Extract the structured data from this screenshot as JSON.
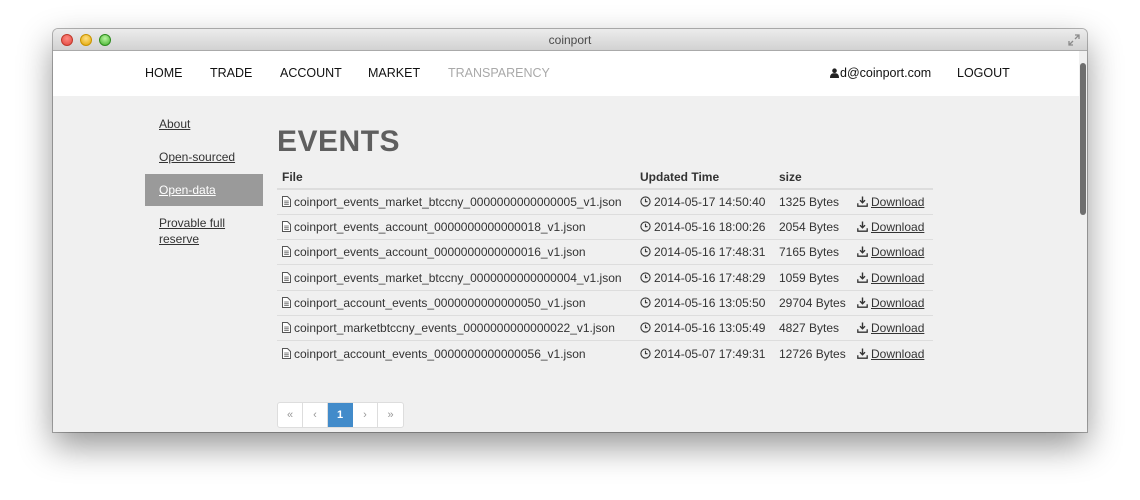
{
  "window": {
    "title": "coinport"
  },
  "nav": {
    "items": [
      "HOME",
      "TRADE",
      "ACCOUNT",
      "MARKET",
      "TRANSPARENCY"
    ],
    "user_email": "d@coinport.com",
    "logout": "LOGOUT"
  },
  "sidebar": {
    "items": [
      "About",
      "Open-sourced",
      "Open-data",
      "Provable full reserve"
    ],
    "active": "Open-data"
  },
  "page": {
    "title": "EVENTS"
  },
  "table": {
    "headers": [
      "File",
      "Updated Time",
      "size"
    ],
    "rows": [
      {
        "file": "coinport_events_market_btccny_0000000000000005_v1.json",
        "time": "2014-05-17 14:50:40",
        "size": "1325 Bytes",
        "action": "Download"
      },
      {
        "file": "coinport_events_account_0000000000000018_v1.json",
        "time": "2014-05-16 18:00:26",
        "size": "2054 Bytes",
        "action": "Download"
      },
      {
        "file": "coinport_events_account_0000000000000016_v1.json",
        "time": "2014-05-16 17:48:31",
        "size": "7165 Bytes",
        "action": "Download"
      },
      {
        "file": "coinport_events_market_btccny_0000000000000004_v1.json",
        "time": "2014-05-16 17:48:29",
        "size": "1059 Bytes",
        "action": "Download"
      },
      {
        "file": "coinport_account_events_0000000000000050_v1.json",
        "time": "2014-05-16 13:05:50",
        "size": "29704 Bytes",
        "action": "Download"
      },
      {
        "file": "coinport_marketbtccny_events_0000000000000022_v1.json",
        "time": "2014-05-16 13:05:49",
        "size": "4827 Bytes",
        "action": "Download"
      },
      {
        "file": "coinport_account_events_0000000000000056_v1.json",
        "time": "2014-05-07 17:49:31",
        "size": "12726 Bytes",
        "action": "Download"
      }
    ]
  },
  "pagination": {
    "first": "«",
    "prev": "‹",
    "current": "1",
    "next": "›",
    "last": "»"
  },
  "colors": {
    "active_page": "#428bca",
    "sidebar_active": "#9a9a9a",
    "title": "#5f5f5f"
  }
}
